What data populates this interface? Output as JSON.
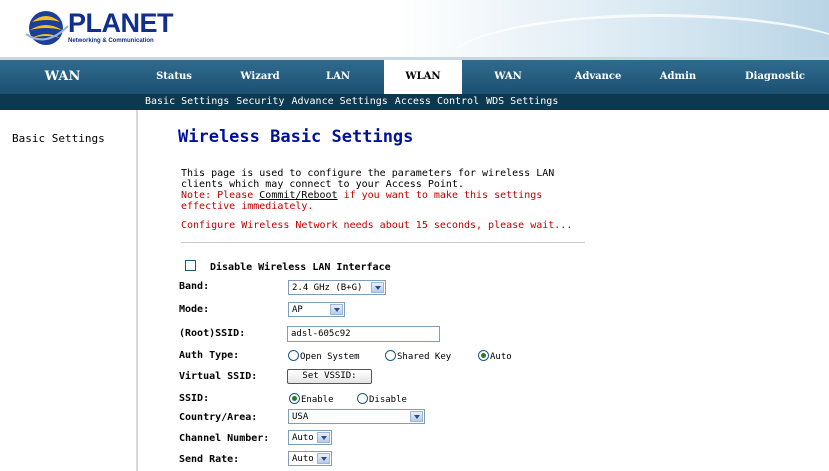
{
  "header": {
    "logo_text": "PLANET",
    "logo_sub": "Networking & Communication"
  },
  "nav": {
    "side_label": "WAN",
    "tabs": [
      {
        "label": "Status"
      },
      {
        "label": "Wizard"
      },
      {
        "label": "LAN"
      },
      {
        "label": "WLAN"
      },
      {
        "label": "WAN"
      },
      {
        "label": "Advance"
      },
      {
        "label": "Admin"
      },
      {
        "label": "Diagnostic"
      }
    ],
    "active_tab": "WLAN"
  },
  "subnav": {
    "items": [
      "Basic Settings",
      "Security",
      "Advance Settings",
      "Access Control",
      "WDS Settings"
    ]
  },
  "sidebar": {
    "items": [
      "Basic Settings"
    ]
  },
  "page": {
    "title": "Wireless Basic Settings",
    "desc": "This page is used to configure the parameters for wireless LAN clients which may connect to your Access Point.",
    "note_prefix": "Note: Please ",
    "note_link": "Commit/Reboot",
    "note_suffix": " if you want to make this settings effective immediately.",
    "config_msg": "Configure Wireless Network needs about 15 seconds, please wait..."
  },
  "form": {
    "disable_label": "Disable Wireless LAN Interface",
    "band_label": "Band:",
    "band_value": "2.4 GHz (B+G)",
    "mode_label": "Mode:",
    "mode_value": "AP",
    "ssid_label": "(Root)SSID:",
    "ssid_value": "adsl-605c92",
    "auth_label": "Auth Type:",
    "auth_options": [
      "Open System",
      "Shared Key",
      "Auto"
    ],
    "auth_selected": "Auto",
    "vssid_label": "Virtual SSID:",
    "vssid_button": "Set VSSID:",
    "ssid_bcast_label": "SSID:",
    "ssid_bcast_options": [
      "Enable",
      "Disable"
    ],
    "ssid_bcast_selected": "Enable",
    "country_label": "Country/Area:",
    "country_value": "USA",
    "channel_label": "Channel Number:",
    "channel_value": "Auto",
    "rate_label": "Send Rate:",
    "rate_value": "Auto"
  }
}
